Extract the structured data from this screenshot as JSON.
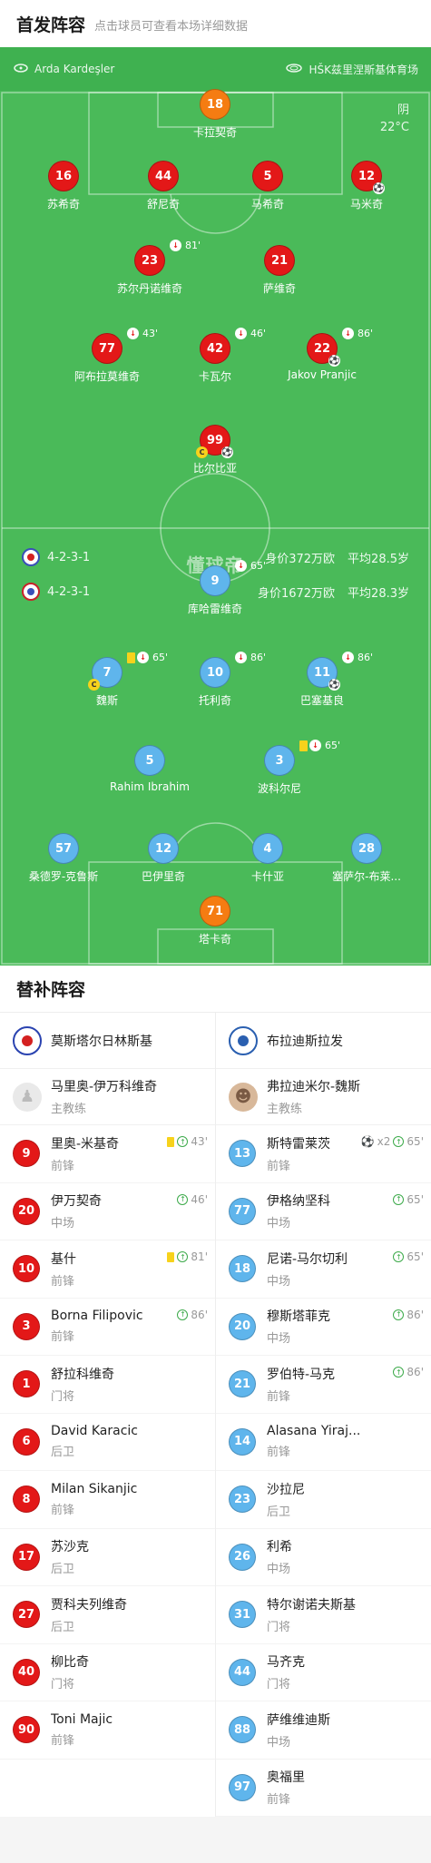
{
  "header": {
    "title": "首发阵容",
    "subtitle": "点击球员可查看本场详细数据"
  },
  "venue": {
    "referee": "Arda Kardeşler",
    "stadium": "HŠK兹里涅斯基体育场"
  },
  "weather": {
    "condition": "阴",
    "temperature": "22°C"
  },
  "watermark": "懂球帝",
  "colors": {
    "pitch": "#4aba59",
    "home": "#e31818",
    "away": "#5fb5ec",
    "keeper_home": "#f57c12",
    "yellow_card": "#f7d21c"
  },
  "home_team": {
    "formation": "4-2-3-1",
    "value_label": "身价372万欧",
    "age_label": "平均28.5岁"
  },
  "away_team": {
    "formation": "4-2-3-1",
    "value_label": "身价1672万欧",
    "age_label": "平均28.3岁"
  },
  "home_lineup": [
    {
      "number": "18",
      "name": "卡拉契奇",
      "color": "orange"
    },
    {
      "number": "16",
      "name": "苏希奇",
      "color": "red"
    },
    {
      "number": "44",
      "name": "舒尼奇",
      "color": "red"
    },
    {
      "number": "5",
      "name": "马希奇",
      "color": "red"
    },
    {
      "number": "12",
      "name": "马米奇",
      "color": "red",
      "ball": "⚽"
    },
    {
      "number": "23",
      "name": "苏尔丹诺维奇",
      "color": "red",
      "sub_time": "81'"
    },
    {
      "number": "21",
      "name": "萨维奇",
      "color": "red"
    },
    {
      "number": "77",
      "name": "阿布拉莫维奇",
      "color": "red",
      "sub_time": "43'"
    },
    {
      "number": "42",
      "name": "卡瓦尔",
      "color": "red",
      "sub_time": "46'"
    },
    {
      "number": "22",
      "name": "Jakov Pranjic",
      "color": "red",
      "sub_time": "86'",
      "ball": "⚽"
    },
    {
      "number": "99",
      "name": "比尔比亚",
      "color": "red",
      "captain": "C",
      "ball": "⚽"
    }
  ],
  "away_lineup": [
    {
      "number": "9",
      "name": "库哈雷维奇",
      "color": "blue",
      "sub_time": "65'"
    },
    {
      "number": "7",
      "name": "魏斯",
      "color": "blue",
      "sub_time": "65'",
      "captain": "C"
    },
    {
      "number": "10",
      "name": "托利奇",
      "color": "blue",
      "sub_time": "86'"
    },
    {
      "number": "11",
      "name": "巴塞基良",
      "color": "blue",
      "sub_time": "86'",
      "ball": "⚽"
    },
    {
      "number": "5",
      "name": "Rahim Ibrahim",
      "color": "blue"
    },
    {
      "number": "3",
      "name": "波科尔尼",
      "color": "blue",
      "sub_time": "65'"
    },
    {
      "number": "57",
      "name": "桑德罗-克鲁斯",
      "color": "blue"
    },
    {
      "number": "12",
      "name": "巴伊里奇",
      "color": "blue"
    },
    {
      "number": "4",
      "name": "卡什亚",
      "color": "blue"
    },
    {
      "number": "28",
      "name": "塞萨尔-布莱...",
      "color": "blue"
    },
    {
      "number": "71",
      "name": "塔卡奇",
      "color": "orange"
    }
  ],
  "subs": {
    "title": "替补阵容",
    "home": {
      "team_name": "莫斯塔尔日林斯基",
      "coach_name": "马里奥-伊万科维奇",
      "coach_role": "主教练",
      "players": [
        {
          "number": "9",
          "name": "里奥-米基奇",
          "position": "前锋",
          "event": "43'",
          "yellow": true
        },
        {
          "number": "20",
          "name": "伊万契奇",
          "position": "中场",
          "event": "46'"
        },
        {
          "number": "10",
          "name": "基什",
          "position": "前锋",
          "event": "81'",
          "yellow": true
        },
        {
          "number": "3",
          "name": "Borna Filipovic",
          "position": "前锋",
          "event": "86'"
        },
        {
          "number": "1",
          "name": "舒拉科维奇",
          "position": "门将"
        },
        {
          "number": "6",
          "name": "David Karacic",
          "position": "后卫"
        },
        {
          "number": "8",
          "name": "Milan Sikanjic",
          "position": "前锋"
        },
        {
          "number": "17",
          "name": "苏沙克",
          "position": "后卫"
        },
        {
          "number": "27",
          "name": "贾科夫列维奇",
          "position": "后卫"
        },
        {
          "number": "40",
          "name": "柳比奇",
          "position": "门将"
        },
        {
          "number": "90",
          "name": "Toni Majic",
          "position": "前锋"
        }
      ]
    },
    "away": {
      "team_name": "布拉迪斯拉发",
      "coach_name": "弗拉迪米尔-魏斯",
      "coach_role": "主教练",
      "players": [
        {
          "number": "13",
          "name": "斯特雷莱茨",
          "position": "前锋",
          "event": "65'",
          "goals": "x2"
        },
        {
          "number": "77",
          "name": "伊格纳坚科",
          "position": "中场",
          "event": "65'"
        },
        {
          "number": "18",
          "name": "尼诺-马尔切利",
          "position": "中场",
          "event": "65'"
        },
        {
          "number": "20",
          "name": "穆斯塔菲克",
          "position": "中场",
          "event": "86'"
        },
        {
          "number": "21",
          "name": "罗伯特-马克",
          "position": "前锋",
          "event": "86'"
        },
        {
          "number": "14",
          "name": "Alasana Yiraj...",
          "position": "前锋"
        },
        {
          "number": "23",
          "name": "沙拉尼",
          "position": "后卫"
        },
        {
          "number": "26",
          "name": "利希",
          "position": "中场"
        },
        {
          "number": "31",
          "name": "特尔谢诺夫斯基",
          "position": "门将"
        },
        {
          "number": "44",
          "name": "马齐克",
          "position": "门将"
        },
        {
          "number": "88",
          "name": "萨维维迪斯",
          "position": "中场"
        },
        {
          "number": "97",
          "name": "奥福里",
          "position": "前锋"
        }
      ]
    }
  }
}
